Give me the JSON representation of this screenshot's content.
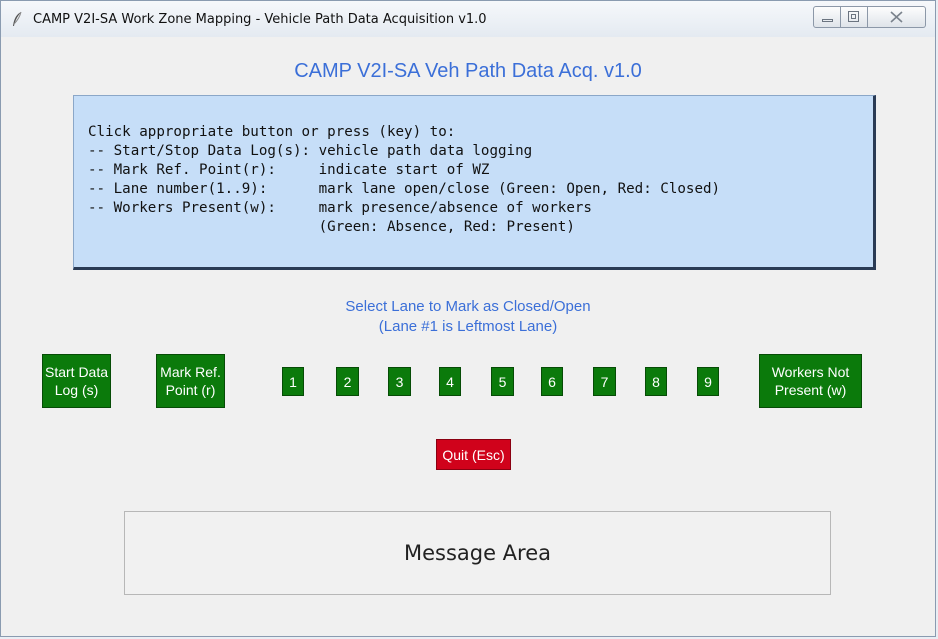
{
  "window": {
    "title": "CAMP V2I-SA Work Zone Mapping - Vehicle Path Data Acquisition v1.0"
  },
  "header": {
    "app_title": "CAMP V2I-SA Veh Path Data Acq. v1.0"
  },
  "instructions": {
    "lines": [
      "Click appropriate button or press (key) to:",
      "-- Start/Stop Data Log(s): vehicle path data logging",
      "-- Mark Ref. Point(r):     indicate start of WZ",
      "-- Lane number(1..9):      mark lane open/close (Green: Open, Red: Closed)",
      "-- Workers Present(w):     mark presence/absence of workers",
      "                           (Green: Absence, Red: Present)"
    ]
  },
  "lane_caption": {
    "line1": "Select Lane to Mark as Closed/Open",
    "line2": "(Lane #1 is Leftmost Lane)"
  },
  "controls": {
    "start_line1": "Start Data",
    "start_line2": "Log (s)",
    "mark_line1": "Mark Ref.",
    "mark_line2": "Point (r)",
    "workers_line1": "Workers Not",
    "workers_line2": "Present (w)",
    "lanes": [
      "1",
      "2",
      "3",
      "4",
      "5",
      "6",
      "7",
      "8",
      "9"
    ],
    "quit": "Quit (Esc)"
  },
  "message_area": {
    "text": "Message Area"
  },
  "colors": {
    "title_blue": "#3b6fd8",
    "instr_bg": "#c6def8",
    "button_green": "#0b7a0b",
    "quit_red": "#d0021b"
  }
}
